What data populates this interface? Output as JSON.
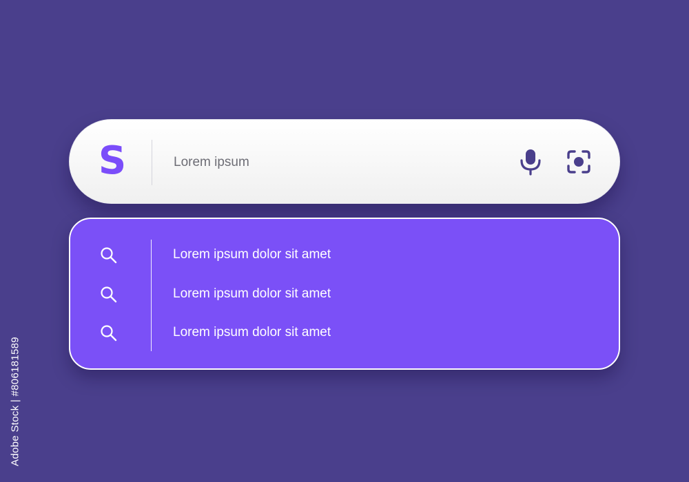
{
  "search_bar": {
    "logo_letter": "S",
    "placeholder": "Lorem ipsum",
    "icons": [
      "microphone-icon",
      "lens-scan-icon"
    ]
  },
  "suggestions": {
    "items": [
      {
        "label": "Lorem ipsum dolor sit amet",
        "icon": "search-icon"
      },
      {
        "label": "Lorem ipsum dolor sit amet",
        "icon": "search-icon"
      },
      {
        "label": "Lorem ipsum dolor sit amet",
        "icon": "search-icon"
      }
    ]
  },
  "stock_id": "Adobe Stock | #806181589",
  "colors": {
    "background": "#4a3f8c",
    "accent": "#7b4dfa",
    "panel": "#7b50f7",
    "icon": "#4a3f8c",
    "text_muted": "#6d6d75"
  }
}
